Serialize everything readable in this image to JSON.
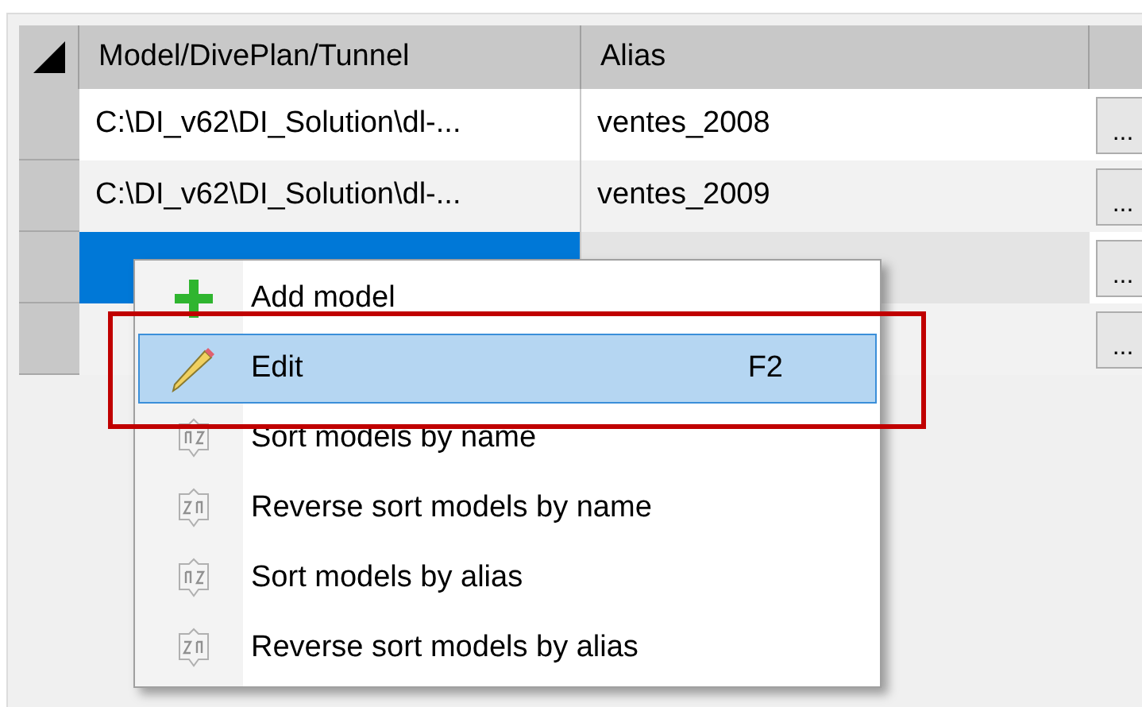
{
  "table": {
    "columns": [
      "Model/DivePlan/Tunnel",
      "Alias"
    ],
    "rows": [
      {
        "model": "C:\\DI_v62\\DI_Solution\\dl-...",
        "alias": "ventes_2008",
        "button": "...",
        "selected": false
      },
      {
        "model": "C:\\DI_v62\\DI_Solution\\dl-...",
        "alias": "ventes_2009",
        "button": "...",
        "selected": false
      },
      {
        "model": "",
        "alias": "",
        "button": "...",
        "selected": true
      },
      {
        "model": "",
        "alias": "",
        "button": "...",
        "selected": false
      }
    ]
  },
  "context_menu": {
    "items": [
      {
        "kind": "add",
        "label": "Add model",
        "selected": false
      },
      {
        "kind": "edit",
        "label": "Edit",
        "shortcut": "F2",
        "selected": true
      },
      {
        "kind": "sort_az",
        "label": "Sort models by name",
        "selected": false
      },
      {
        "kind": "sort_za",
        "label": "Reverse sort models by name",
        "selected": false
      },
      {
        "kind": "sort_az",
        "label": "Sort models by alias",
        "selected": false
      },
      {
        "kind": "sort_za",
        "label": "Reverse sort models by alias",
        "selected": false
      }
    ]
  }
}
